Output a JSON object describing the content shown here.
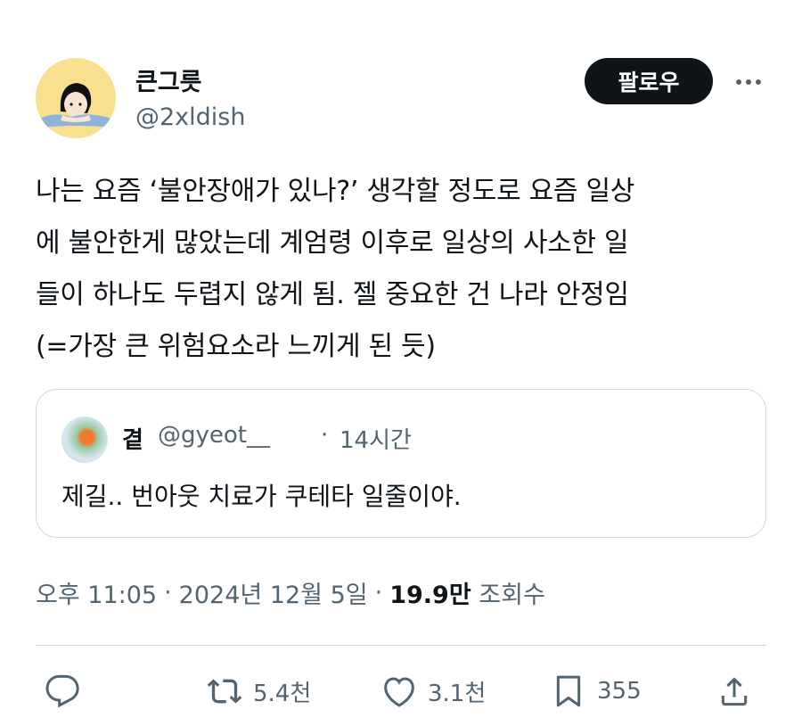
{
  "author": {
    "display_name": "큰그릇",
    "handle": "@2xldish",
    "follow_label": "팔로우"
  },
  "tweet": {
    "text": "나는 요즘 ‘불안장애가 있나?’ 생각할 정도로 요즘 일상\n에 불안한게 많았는데 계엄령 이후로 일상의 사소한 일\n들이 하나도 두렵지 않게 됨. 젤 중요한 건 나라 안정임\n(=가장 큰 위험요소라 느끼게 된 듯)"
  },
  "quoted_tweet": {
    "display_name": "곁",
    "handle": "@gyeot__",
    "separator": "·",
    "time": "14시간",
    "text": "제길.. 번아웃 치료가 쿠테타 일줄이야."
  },
  "meta": {
    "time": "오후 11:05",
    "sep1": "·",
    "date": "2024년 12월 5일",
    "sep2": "·",
    "views_count": "19.9만",
    "views_label": "조회수"
  },
  "actions": {
    "reply_icon": "reply-icon",
    "retweet_count": "5.4천",
    "like_count": "3.1천",
    "bookmark_count": "355"
  },
  "colors": {
    "text": "#0f1419",
    "secondary": "#536471",
    "border": "#cfd9de",
    "avatar_bg": "#f8e08e"
  }
}
